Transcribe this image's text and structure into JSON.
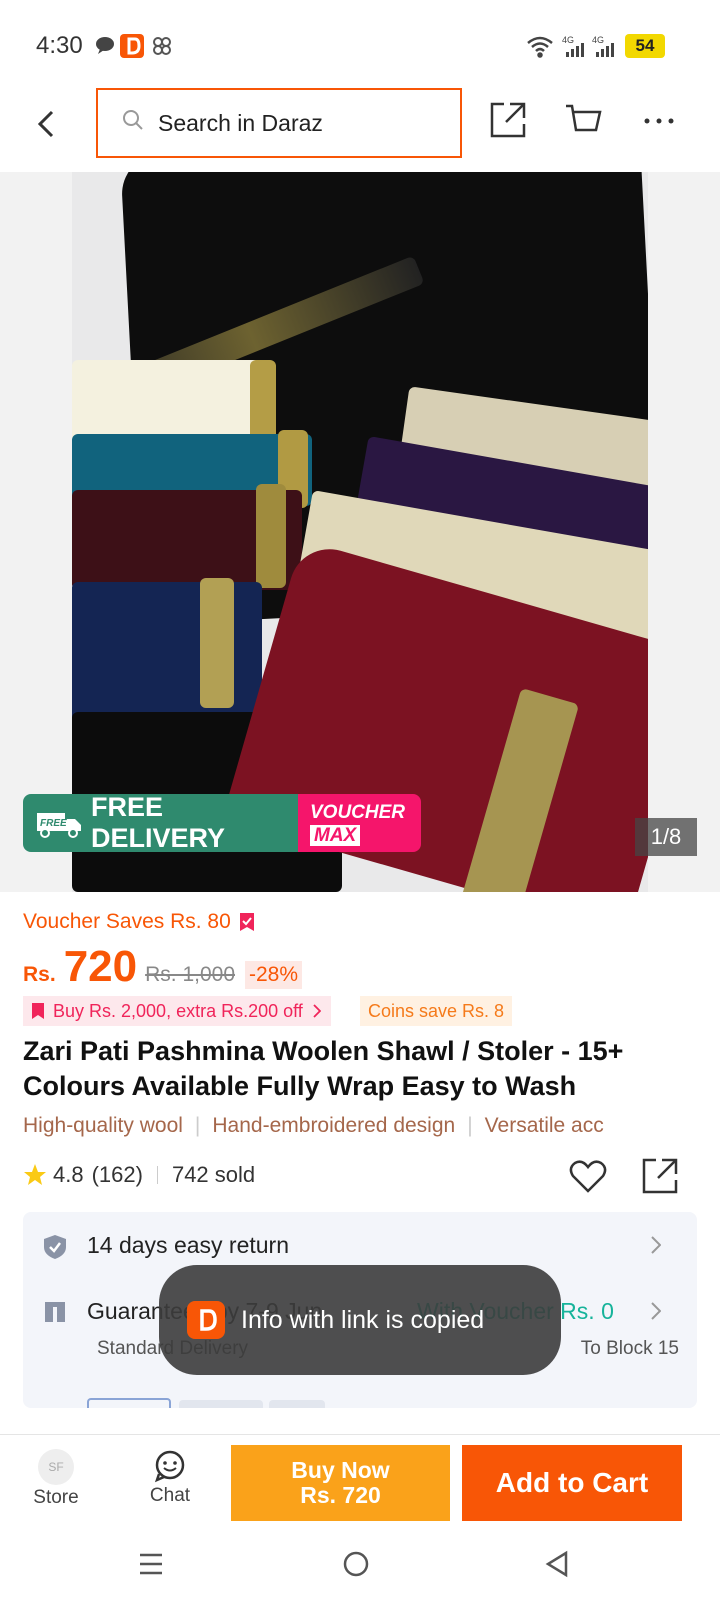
{
  "status_bar": {
    "time": "4:30",
    "battery": "54"
  },
  "header": {
    "search_placeholder": "Search in Daraz"
  },
  "gallery": {
    "badge_free_delivery": "FREE DELIVERY",
    "badge_free_tag": "FREE",
    "badge_voucher_line1": "VOUCHER",
    "badge_voucher_line2": "MAX",
    "counter": "1/8"
  },
  "product": {
    "voucher_saves": "Voucher Saves Rs. 80",
    "currency": "Rs.",
    "price": "720",
    "original_price": "Rs. 1,000",
    "discount": "-28%",
    "promo_buy": "Buy Rs. 2,000, extra Rs.200 off",
    "promo_coins": "Coins save Rs. 8",
    "title": "Zari Pati Pashmina Woolen Shawl / Stoler - 15+ Colours Available Fully Wrap Easy to Wash",
    "highlights": [
      "High-quality wool",
      "Hand-embroidered design",
      "Versatile acc"
    ],
    "rating": "4.8",
    "rating_count": "(162)",
    "sold": "742 sold"
  },
  "service_card": {
    "return_text": "14 days easy return",
    "delivery_text": "Guaranteed by 7-9 Jun",
    "voucher_text": "With Voucher Rs. 0",
    "delivery_type": "Standard Delivery",
    "destination": "To Block 15"
  },
  "toast": {
    "text": "Info with link is copied"
  },
  "bottom_bar": {
    "store_label": "Store",
    "store_avatar": "SF",
    "chat_label": "Chat",
    "buy_now_line1": "Buy Now",
    "buy_now_line2": "Rs. 720",
    "add_to_cart": "Add to Cart"
  },
  "colors": {
    "accent": "#f85606",
    "buy_now": "#faa21a",
    "add_to_cart": "#f85606",
    "free_delivery": "#2f8a6e",
    "voucher_max": "#f5156b",
    "voucher_green": "#16b39a"
  }
}
